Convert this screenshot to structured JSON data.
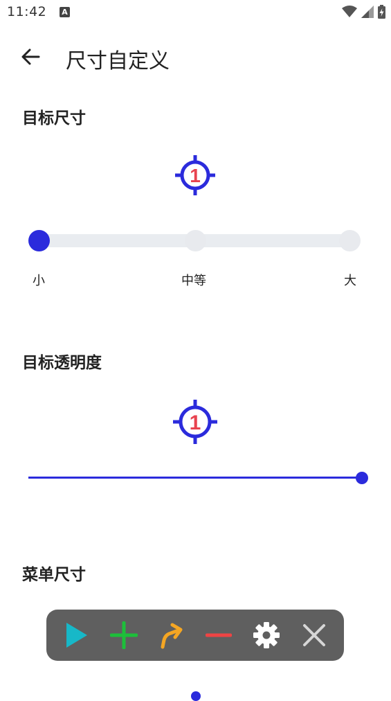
{
  "status_bar": {
    "time": "11:42",
    "notification_badge": "A"
  },
  "app_bar": {
    "title": "尺寸自定义",
    "back_icon": "arrow-left-icon"
  },
  "target_size": {
    "heading": "目标尺寸",
    "preview_number": "1",
    "options": [
      "小",
      "中等",
      "大"
    ],
    "selected": "小"
  },
  "target_opacity": {
    "heading": "目标透明度",
    "preview_number": "1",
    "value_percent": 100
  },
  "menu_size": {
    "heading": "菜单尺寸",
    "menu_icons": [
      "play-icon",
      "plus-icon",
      "redirect-arrow-icon",
      "minus-icon",
      "gear-icon",
      "close-icon"
    ]
  },
  "colors": {
    "accent": "#2b2bdc",
    "target_number": "#e8434f",
    "play": "#17b8c8",
    "plus": "#1dbf3a",
    "arrow": "#f5a623",
    "minus": "#ef4444",
    "menu_bg": "#5f5f5f"
  }
}
